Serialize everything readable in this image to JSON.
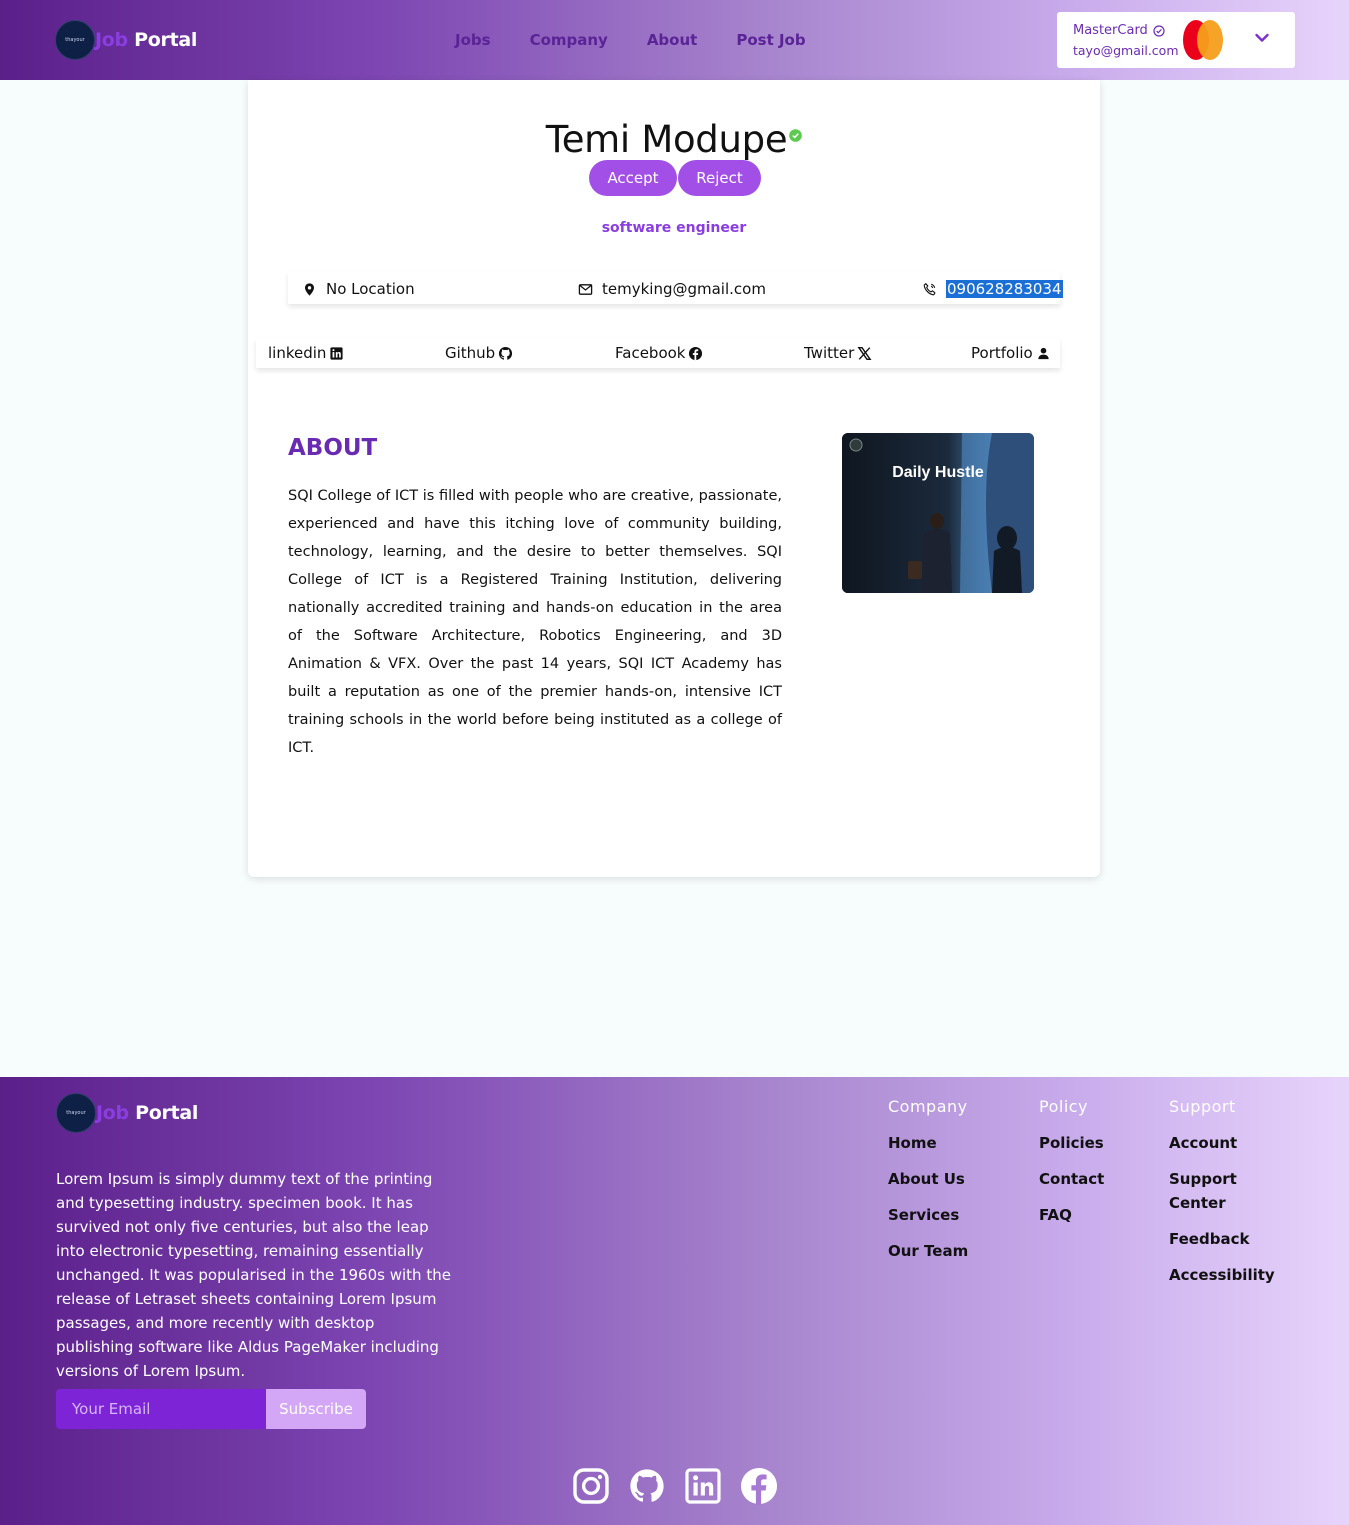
{
  "header": {
    "logo_badge": "thayour",
    "logo_job": "Job",
    "logo_portal": "Portal",
    "nav": [
      "Jobs",
      "Company",
      "About",
      "Post Job"
    ],
    "account_name": "MasterCard",
    "account_email": "tayo@gmail.com"
  },
  "profile": {
    "name": "Temi Modupe",
    "accept_label": "Accept",
    "reject_label": "Reject",
    "role": "software engineer",
    "location": "No Location",
    "email": "temyking@gmail.com",
    "phone": "09062828303",
    "phone_last": "4",
    "social": [
      "linkedin",
      "Github",
      "Facebook",
      "Twitter",
      "Portfolio"
    ],
    "about_title": "ABOUT",
    "about_text": "SQI College of ICT is filled with people who are creative, passionate, experienced and have this itching love of community building, technology, learning, and the desire to better themselves. SQI College of ICT is a Registered Training Institution, delivering nationally accredited training and hands-on education in the area of the Software Architecture, Robotics Engineering, and 3D Animation & VFX. Over the past 14 years, SQI ICT Academy has built a reputation as one of the premier hands-on, intensive ICT training schools in the world before being instituted as a college of ICT.",
    "album_title": "Daily Hustle"
  },
  "footer": {
    "description": "Lorem Ipsum is simply dummy text of the printing and typesetting industry. specimen book. It has survived not only five centuries, but also the leap into electronic typesetting, remaining essentially unchanged. It was popularised in the 1960s with the release of Letraset sheets containing Lorem Ipsum passages, and more recently with desktop publishing software like Aldus PageMaker including versions of Lorem Ipsum.",
    "email_placeholder": "Your Email",
    "subscribe_label": "Subscribe",
    "columns": [
      {
        "title": "Company",
        "links": [
          "Home",
          "About Us",
          "Services",
          "Our Team"
        ]
      },
      {
        "title": "Policy",
        "links": [
          "Policies",
          "Contact",
          "FAQ"
        ]
      },
      {
        "title": "Support",
        "links": [
          "Account",
          "Support Center",
          "Feedback",
          "Accessibility"
        ]
      }
    ],
    "social_icons": [
      "instagram-icon",
      "github-icon",
      "linkedin-icon",
      "facebook-icon"
    ]
  },
  "colors": {
    "accent": "#8a3ee0",
    "button": "#a24fe8",
    "header_start": "#5b1f8a",
    "header_end": "#e7d4fb",
    "verified": "#5cc94f",
    "selection": "#1a6fd6"
  }
}
